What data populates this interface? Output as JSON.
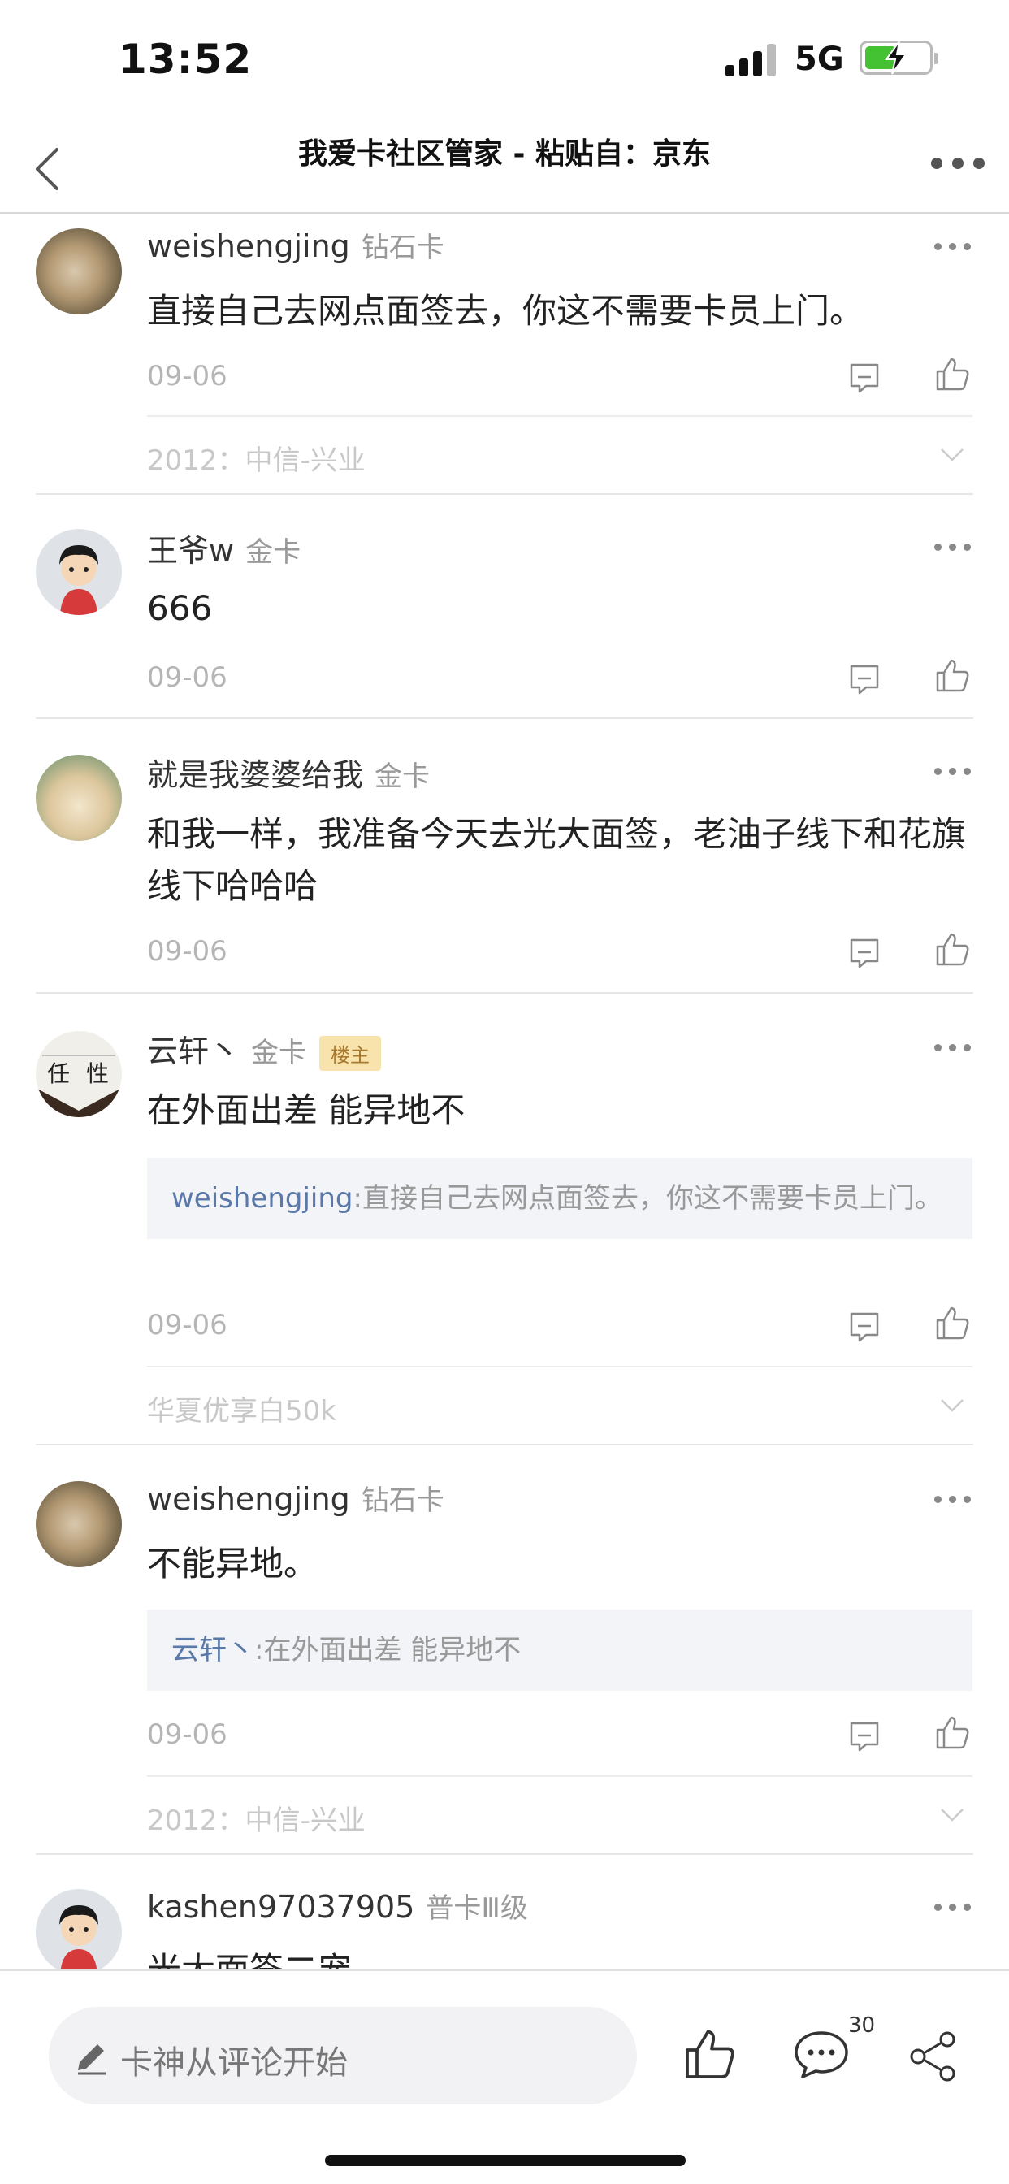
{
  "status": {
    "time": "13:52",
    "network": "5G"
  },
  "nav": {
    "title": "我爱卡社区管家 - 粘贴自：京东"
  },
  "comments": [
    {
      "user": "weishengjing",
      "level": "钻石卡",
      "text": "直接自己去网点面签去，你这不需要卡员上门。",
      "date": "09-06",
      "tag": "2012：中信-兴业"
    },
    {
      "user": "王爷w",
      "level": "金卡",
      "text": "666",
      "date": "09-06"
    },
    {
      "user": "就是我婆婆给我",
      "level": "金卡",
      "text": "和我一样，我准备今天去光大面签，老油子线下和花旗线下哈哈哈",
      "date": "09-06"
    },
    {
      "user": "云轩丶",
      "level": "金卡",
      "badge": "楼主",
      "text": "在外面出差 能异地不",
      "quote_user": "weishengjing",
      "quote_text": ":直接自己去网点面签去，你这不需要卡员上门。",
      "date": "09-06",
      "tag": "华夏优享白50k"
    },
    {
      "user": "weishengjing",
      "level": "钻石卡",
      "text": "不能异地。",
      "quote_user": "云轩丶",
      "quote_text": ":在外面出差 能异地不",
      "date": "09-06",
      "tag": "2012：中信-兴业"
    },
    {
      "user": "kashen97037905",
      "level": "普卡Ⅲ级",
      "text": "光大面签二宠"
    }
  ],
  "bottom": {
    "placeholder": "卡神从评论开始",
    "comment_count": "30"
  },
  "colors": {
    "quote_name": "#5a79a8",
    "owner_badge_bg": "#f8e3ad",
    "battery_fill": "#45c233"
  }
}
